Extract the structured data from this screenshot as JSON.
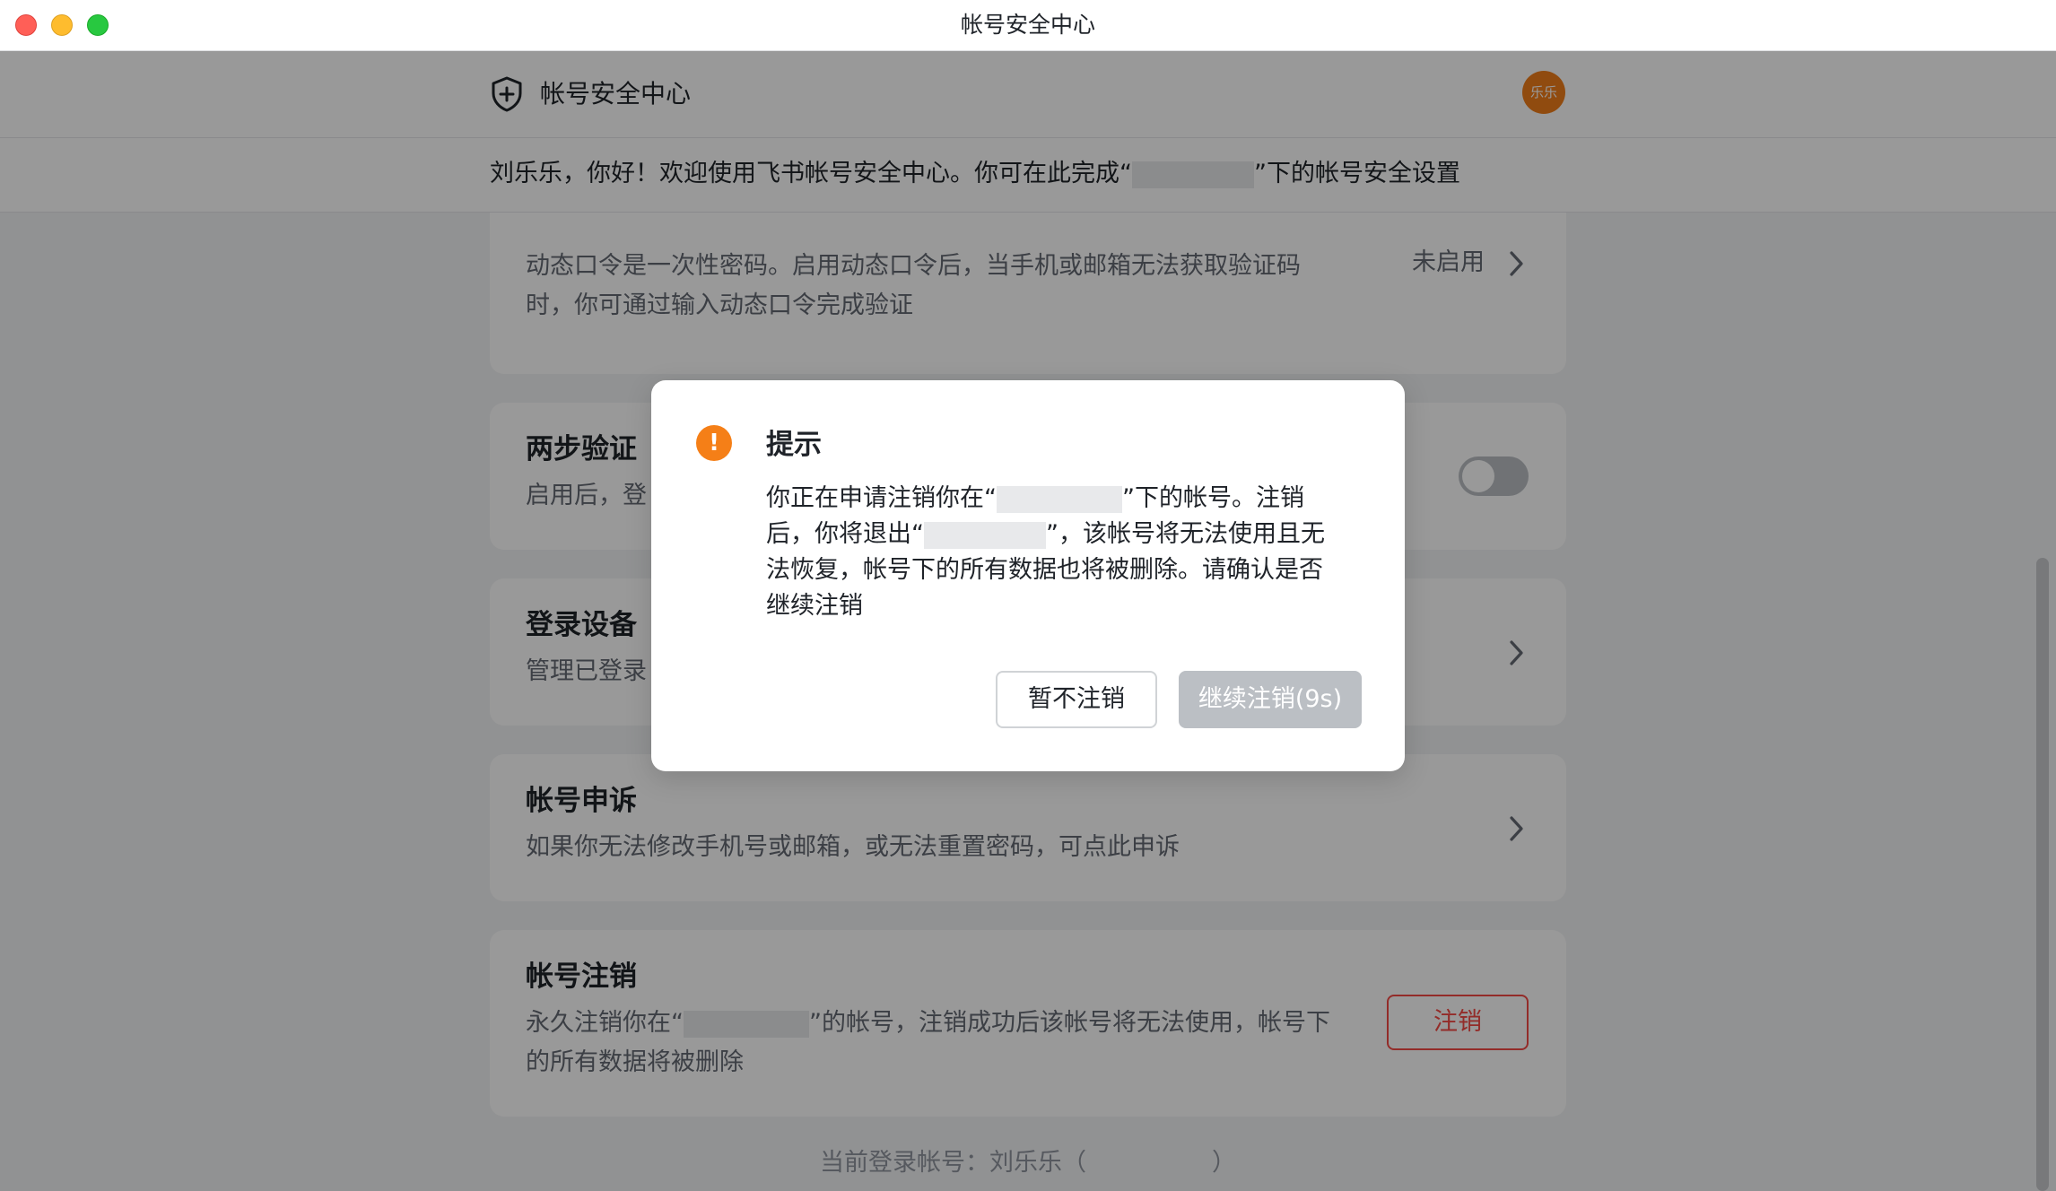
{
  "window": {
    "title": "帐号安全中心"
  },
  "header": {
    "app_name": "帐号安全中心",
    "avatar_text": "乐乐"
  },
  "welcome": {
    "before": "刘乐乐，你好！欢迎使用飞书帐号安全中心。你可在此完成“",
    "after": "”下的帐号安全设置"
  },
  "cards": {
    "otp": {
      "desc_line1": "动态口令是一次性密码。启用动态口令后，当手机或邮箱无法获取验证码",
      "desc_line2": "时，你可通过输入动态口令完成验证",
      "status": "未启用"
    },
    "two_step": {
      "title": "两步验证",
      "desc": "启用后，登",
      "enabled": false
    },
    "devices": {
      "title": "登录设备",
      "desc": "管理已登录"
    },
    "appeal": {
      "title": "帐号申诉",
      "desc": "如果你无法修改手机号或邮箱，或无法重置密码，可点此申诉"
    },
    "deactivate": {
      "title": "帐号注销",
      "desc_before": "永久注销你在“",
      "desc_after": "”的帐号，注销成功后该帐号将无法使用，帐号下",
      "desc_line2": "的所有数据将被删除",
      "button_label": "注销"
    }
  },
  "footer": {
    "before": "当前登录帐号：刘乐乐（",
    "after": "）"
  },
  "modal": {
    "icon": "!",
    "title": "提示",
    "body_1": "你正在申请注销你在“",
    "body_2": "”下的帐号。注销",
    "body_3": "后，你将退出“",
    "body_4": "”，该帐号将无法使用且无",
    "body_5": "法恢复，帐号下的所有数据也将被删除。请确认是否",
    "body_6": "继续注销",
    "cancel_label": "暂不注销",
    "confirm_label": "继续注销(9s)"
  },
  "colors": {
    "accent_orange": "#f57f17",
    "danger": "#f54a45",
    "disabled_button": "#bbbfc4"
  }
}
